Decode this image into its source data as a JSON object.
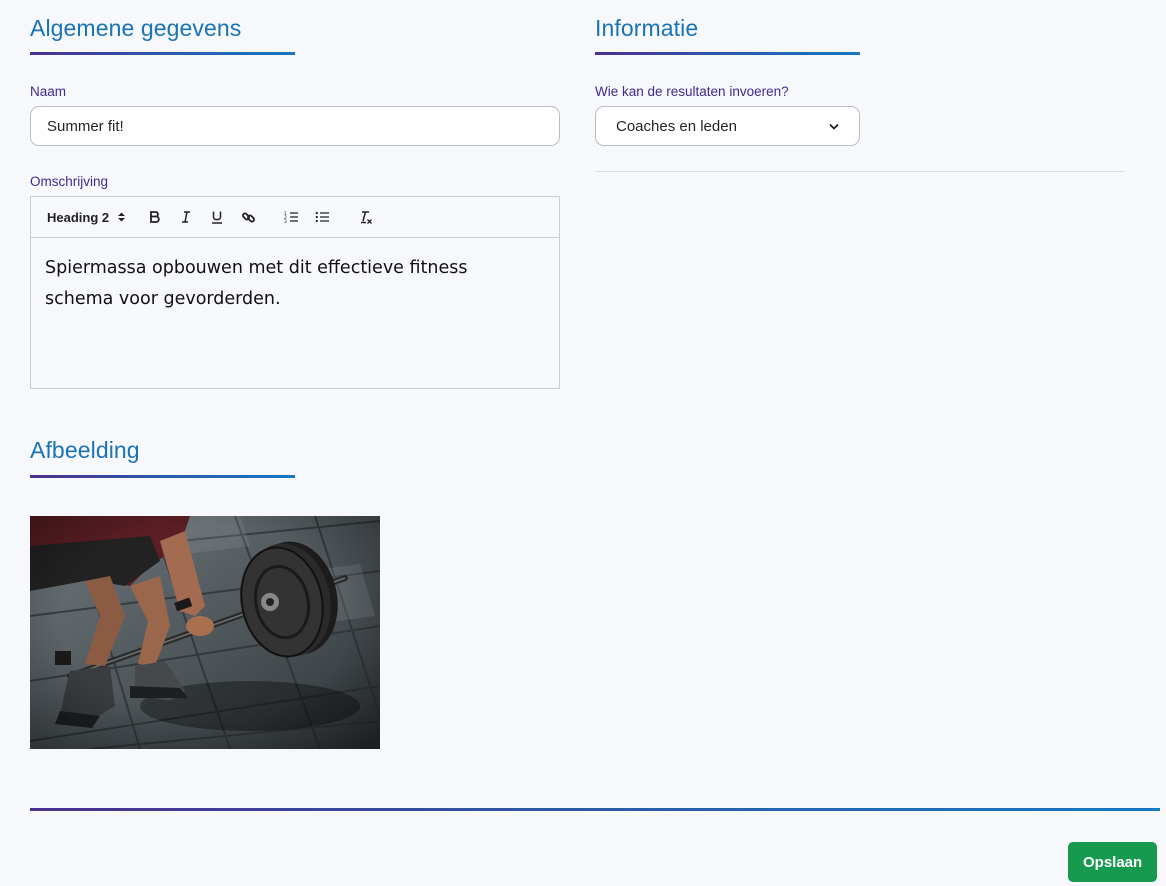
{
  "general": {
    "title": "Algemene gegevens",
    "name_label": "Naam",
    "name_value": "Summer fit!",
    "description_label": "Omschrijving",
    "toolbar": {
      "heading_value": "Heading 2",
      "icons": [
        "bold-icon",
        "italic-icon",
        "underline-icon",
        "link-icon",
        "ordered-list-icon",
        "bullet-list-icon",
        "clear-format-icon"
      ]
    },
    "description_text": "Spiermassa opbouwen met dit effectieve fitness schema voor gevorderden."
  },
  "info": {
    "title": "Informatie",
    "who_label": "Wie kan de resultaten invoeren?",
    "who_value": "Coaches en leden"
  },
  "image_section": {
    "title": "Afbeelding"
  },
  "actions": {
    "save_label": "Opslaan"
  },
  "colors": {
    "accent_blue": "#1a73b6",
    "label_purple": "#3d2c8f",
    "save_green": "#169a4f",
    "background": "#f6f8fb"
  }
}
